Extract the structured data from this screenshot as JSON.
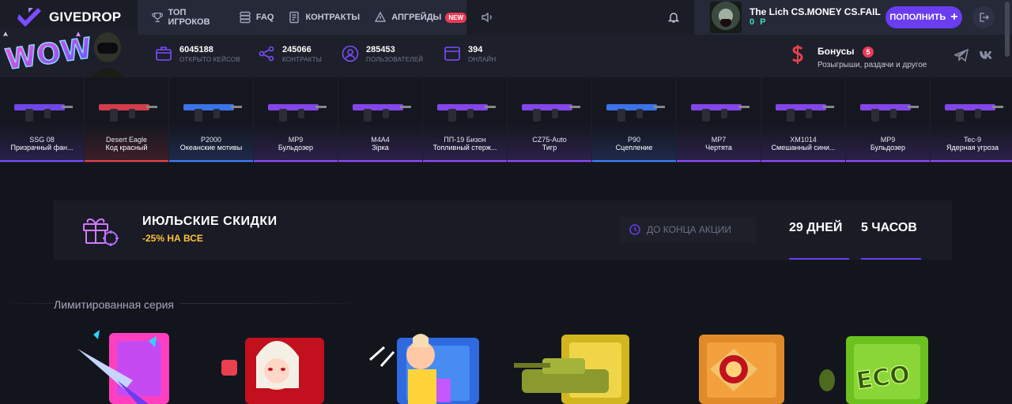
{
  "brand": {
    "name": "GIVEDROP"
  },
  "nav": {
    "items": [
      {
        "label": "ТОП ИГРОКОВ",
        "icon": "trophy-icon"
      },
      {
        "label": "FAQ",
        "icon": "faq-stack-icon"
      },
      {
        "label": "КОНТРАКТЫ",
        "icon": "contract-icon"
      },
      {
        "label": "АПГРЕЙДЫ",
        "icon": "upgrade-icon",
        "badge": "NEW"
      }
    ]
  },
  "user": {
    "name": "The Lich CS.MONEY CS.FAIL",
    "balance": "0 Р",
    "topup_label": "ПОПОЛНИТЬ"
  },
  "promo": {
    "wow_text": "WOW"
  },
  "stats": [
    {
      "value": "6045188",
      "label": "ОТКРЫТО КЕЙСОВ",
      "icon": "case-icon"
    },
    {
      "value": "245066",
      "label": "КОНТРАКТЫ",
      "icon": "share-icon"
    },
    {
      "value": "285453",
      "label": "ПОЛЬЗОВАТЕЛЕЙ",
      "icon": "user-icon"
    },
    {
      "value": "394",
      "label": "ОНЛАЙН",
      "icon": "window-icon"
    }
  ],
  "bonus": {
    "title": "Бонусы",
    "count": "5",
    "subtitle": "Розыгрыши, раздачи и другое"
  },
  "drops": [
    {
      "weapon": "SSG 08",
      "skin": "Призрачный фан...",
      "color": "#7a4bff"
    },
    {
      "weapon": "Desert Eagle",
      "skin": "Код красный",
      "color": "#e8404f"
    },
    {
      "weapon": "P2000",
      "skin": "Океанские мотивы",
      "color": "#3f7dff"
    },
    {
      "weapon": "MP9",
      "skin": "Бульдозер",
      "color": "#8e4bff"
    },
    {
      "weapon": "M4A4",
      "skin": "Зірка",
      "color": "#8e4bff"
    },
    {
      "weapon": "ПП-19 Бизон",
      "skin": "Топливный стерж...",
      "color": "#8e4bff"
    },
    {
      "weapon": "CZ75-Auto",
      "skin": "Тигр",
      "color": "#8e4bff"
    },
    {
      "weapon": "P90",
      "skin": "Сцепление",
      "color": "#3f7dff"
    },
    {
      "weapon": "MP7",
      "skin": "Чертята",
      "color": "#8e4bff"
    },
    {
      "weapon": "XM1014",
      "skin": "Смешанный сини...",
      "color": "#8e4bff"
    },
    {
      "weapon": "MP9",
      "skin": "Бульдозер",
      "color": "#8e4bff"
    },
    {
      "weapon": "Tec-9",
      "skin": "Ядерная угроза",
      "color": "#8e4bff"
    }
  ],
  "sale": {
    "title": "ИЮЛЬСКИЕ СКИДКИ",
    "subtitle": "-25% НА ВСЕ",
    "until_label": "ДО КОНЦА АКЦИИ",
    "days": "29 ДНЕЙ",
    "hours": "5 ЧАСОВ"
  },
  "section": {
    "title": "Лимитированная серия"
  },
  "colors": {
    "accent": "#6a3df0",
    "balance": "#3de0b4",
    "badge": "#e83b57",
    "sale_gold": "#ffc23a"
  }
}
